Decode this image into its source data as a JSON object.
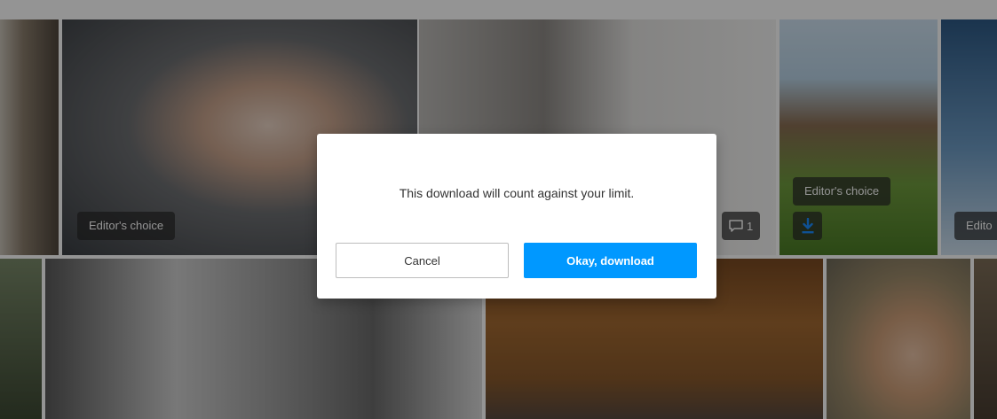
{
  "gallery": {
    "badges": {
      "editors_choice_1": "Editor's choice",
      "editors_choice_2": "Editor's choice",
      "editors_choice_3_partial": "Edito"
    },
    "comment_count": "1"
  },
  "dialog": {
    "message": "This download will count against your limit.",
    "cancel_label": "Cancel",
    "confirm_label": "Okay, download"
  },
  "colors": {
    "primary_button": "#0098ff",
    "download_icon": "#1a8cff",
    "overlay": "rgba(0,0,0,0.42)"
  },
  "icons": {
    "comment": "comment-icon",
    "download": "download-icon"
  }
}
